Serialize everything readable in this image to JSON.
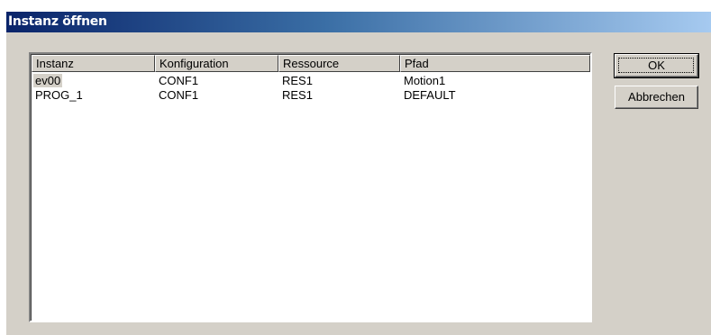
{
  "dialog": {
    "title": "Instanz öffnen"
  },
  "listview": {
    "columns": [
      {
        "label": "Instanz"
      },
      {
        "label": "Konfiguration"
      },
      {
        "label": "Ressource"
      },
      {
        "label": "Pfad"
      }
    ],
    "rows": [
      {
        "instanz": "ev00",
        "konfiguration": "CONF1",
        "ressource": "RES1",
        "pfad": "Motion1"
      },
      {
        "instanz": "PROG_1",
        "konfiguration": "CONF1",
        "ressource": "RES1",
        "pfad": "DEFAULT"
      }
    ]
  },
  "buttons": {
    "ok_label": "OK",
    "cancel_label": "Abbrechen"
  }
}
